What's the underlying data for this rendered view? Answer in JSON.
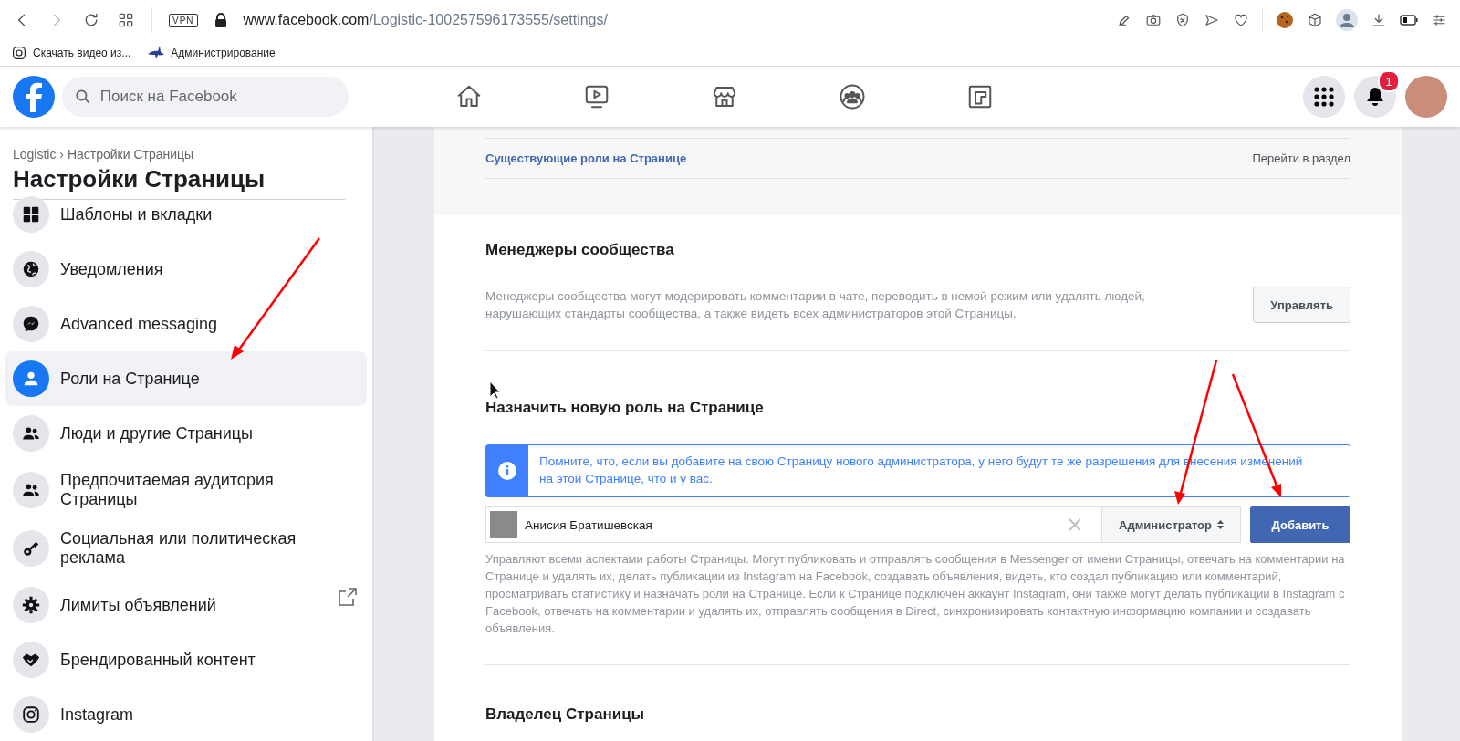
{
  "browser": {
    "url_host": "www.facebook.com",
    "url_path": "/Logistic-100257596173555/settings/",
    "vpn_label": "VPN",
    "bookmarks": [
      {
        "label": "Скачать видео из..."
      },
      {
        "label": "Администрирование"
      }
    ]
  },
  "header": {
    "search": {
      "placeholder": "Поиск на Facebook"
    },
    "notification_count": "1"
  },
  "sidebar": {
    "breadcrumb": "Logistic › Настройки Страницы",
    "title": "Настройки Страницы",
    "items": [
      {
        "label": "Шаблоны и вкладки",
        "selected": false
      },
      {
        "label": "Уведомления",
        "selected": false
      },
      {
        "label": "Advanced messaging",
        "selected": false
      },
      {
        "label": "Роли на Странице",
        "selected": true
      },
      {
        "label": "Люди и другие Страницы",
        "selected": false
      },
      {
        "label": "Предпочитаемая аудитория Страницы",
        "selected": false
      },
      {
        "label": "Социальная или политическая реклама",
        "selected": false
      },
      {
        "label": "Лимиты объявлений",
        "selected": false,
        "external": true
      },
      {
        "label": "Брендированный контент",
        "selected": false
      },
      {
        "label": "Instagram",
        "selected": false
      }
    ]
  },
  "main": {
    "existing_roles": {
      "label": "Существующие роли на Странице",
      "link": "Перейти в раздел"
    },
    "community_managers": {
      "title": "Менеджеры сообщества",
      "description": "Менеджеры сообщества могут модерировать комментарии в чате, переводить в немой режим или удалять людей, нарушающих стандарты сообщества, а также видеть всех администраторов этой Страницы.",
      "button": "Управлять"
    },
    "assign_role": {
      "title": "Назначить новую роль на Странице",
      "notice": "Помните, что, если вы добавите на свою Страницу нового администратора, у него будут те же разрешения для внесения изменений на этой Странице, что и у вас.",
      "person": {
        "value": "Анисия Братишевская"
      },
      "role": "Администратор",
      "button": "Добавить",
      "description": "Управляют всеми аспектами работы Страницы. Могут публиковать и отправлять сообщения в Messenger от имени Страницы, отвечать на комментарии на Странице и удалять их, делать публикации из Instagram на Facebook, создавать объявления, видеть, кто создал публикацию или комментарий, просматривать статистику и назначать роли на Странице. Если к Странице подключен аккаунт Instagram, они также могут делать публикации в Instagram с Facebook, отвечать на комментарии и удалять их, отправлять сообщения в Direct, синхронизировать контактную информацию компании и создавать объявления."
    },
    "owner": {
      "title": "Владелец Страницы"
    }
  }
}
